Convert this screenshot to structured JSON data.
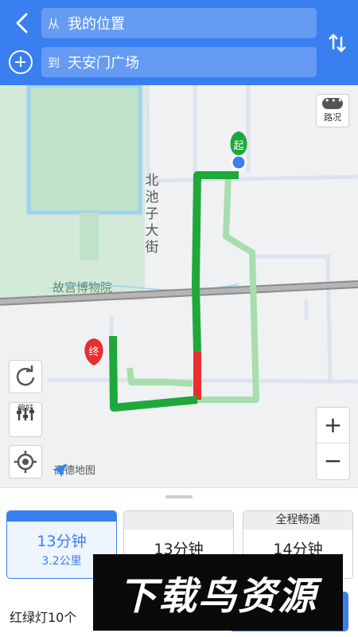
{
  "header": {
    "from_prefix": "从",
    "from_value": "我的位置",
    "to_prefix": "到",
    "to_value": "天安门广场"
  },
  "map": {
    "street_label": "北池子大街",
    "poi_label": "故宫博物院",
    "start_marker": "起",
    "end_marker": "终",
    "traffic_label": "路况",
    "preference_label": "偏好",
    "zoom_in": "+",
    "zoom_out": "−",
    "logo_text": "高德地图",
    "colors": {
      "route_clear": "#1fa83a",
      "route_congested": "#e63030",
      "route_alt": "#a6deac",
      "accent": "#3a7ff0"
    },
    "icons": [
      "back-icon",
      "add-icon",
      "swap-icon",
      "traffic-icon",
      "refresh-icon",
      "preference-icon",
      "locate-icon",
      "amap-logo-icon"
    ]
  },
  "routes": [
    {
      "tag": "",
      "time": "13分钟",
      "distance": "3.2公里",
      "selected": true
    },
    {
      "tag": "",
      "time": "13分钟",
      "distance": ""
    },
    {
      "tag": "全程畅通",
      "time": "14分钟",
      "distance": ""
    }
  ],
  "footer": {
    "traffic_lights": "红绿灯10个"
  },
  "watermark": "下载鸟资源"
}
